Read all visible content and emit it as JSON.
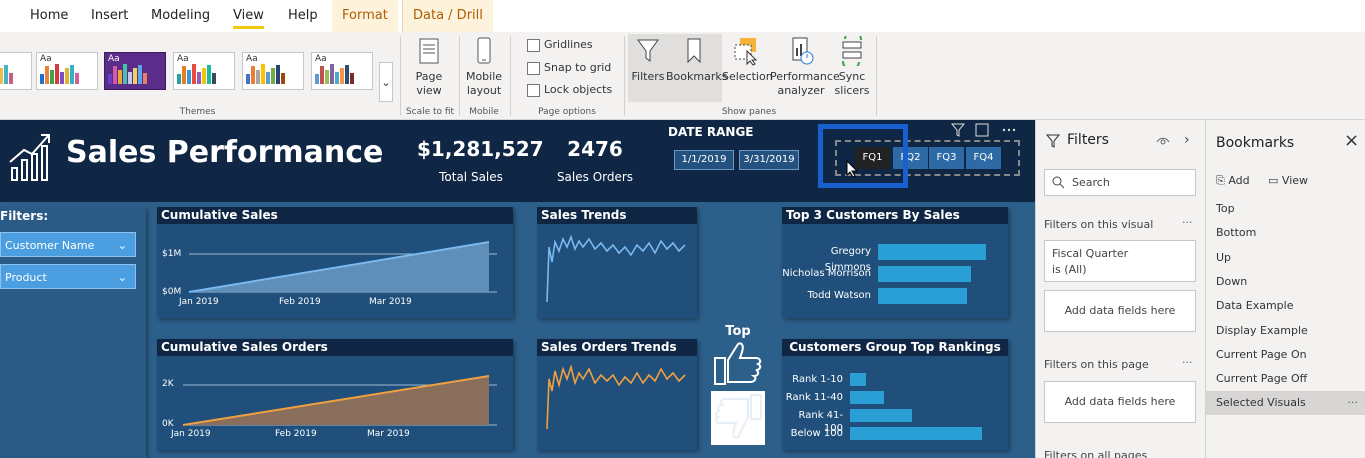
{
  "tabs": {
    "home": "Home",
    "insert": "Insert",
    "modeling": "Modeling",
    "view": "View",
    "help": "Help",
    "format": "Format",
    "data_drill": "Data / Drill"
  },
  "ribbon": {
    "themes_label": "Themes",
    "theme_aa": "Aa",
    "page_view": "Page view",
    "scale_to_fit": "Scale to fit",
    "mobile_layout": "Mobile layout",
    "mobile_label": "Mobile",
    "gridlines": "Gridlines",
    "snap_to_grid": "Snap to grid",
    "lock_objects": "Lock objects",
    "page_options": "Page options",
    "filters": "Filters",
    "bookmarks": "Bookmarks",
    "selection": "Selection",
    "performance_analyzer": "Performance analyzer",
    "sync_slicers": "Sync slicers",
    "show_panes": "Show panes"
  },
  "report": {
    "title": "Sales Performance",
    "total_sales_value": "$1,281,527",
    "total_sales_label": "Total Sales",
    "sales_orders_value": "2476",
    "sales_orders_label": "Sales Orders",
    "date_range_label": "DATE RANGE",
    "date_start": "1/1/2019",
    "date_end": "3/31/2019",
    "quarters": [
      "FQ1",
      "FQ2",
      "FQ3",
      "FQ4"
    ],
    "filters_label": "Filters:",
    "slicers": [
      "Customer Name",
      "Product"
    ],
    "top_label": "Top"
  },
  "charts": {
    "cumulative_sales": {
      "title": "Cumulative Sales",
      "y_ticks": [
        "$1M",
        "$0M"
      ],
      "x_ticks": [
        "Jan 2019",
        "Feb 2019",
        "Mar 2019"
      ]
    },
    "cumulative_orders": {
      "title": "Cumulative Sales Orders",
      "y_ticks": [
        "2K",
        "0K"
      ],
      "x_ticks": [
        "Jan 2019",
        "Feb 2019",
        "Mar 2019"
      ]
    },
    "sales_trends": {
      "title": "Sales Trends"
    },
    "orders_trends": {
      "title": "Sales Orders Trends"
    },
    "top_customers": {
      "title": "Top 3 Customers By Sales",
      "rows": [
        {
          "label": "Gregory Simmons",
          "value": 1.0
        },
        {
          "label": "Nicholas Morrison",
          "value": 0.86
        },
        {
          "label": "Todd Watson",
          "value": 0.82
        }
      ]
    },
    "group_rankings": {
      "title": "Customers Group Top Rankings",
      "rows": [
        {
          "label": "Rank 1-10",
          "value": 0.12
        },
        {
          "label": "Rank 11-40",
          "value": 0.26
        },
        {
          "label": "Rank 41-100",
          "value": 0.47
        },
        {
          "label": "Below 100",
          "value": 1.0
        }
      ]
    }
  },
  "filters_pane": {
    "title": "Filters",
    "search_placeholder": "Search",
    "on_visual": "Filters on this visual",
    "fiscal_quarter": "Fiscal Quarter",
    "is_all": "is (All)",
    "add_fields": "Add data fields here",
    "on_page": "Filters on this page",
    "on_all": "Filters on all pages"
  },
  "bookmarks_pane": {
    "title": "Bookmarks",
    "add": "Add",
    "view": "View",
    "items": [
      "Top",
      "Bottom",
      "Up",
      "Down",
      "Data Example",
      "Display Example",
      "Current Page On",
      "Current Page Off",
      "Selected Visuals"
    ],
    "selected_index": 8
  },
  "colors": {
    "accent": "#f2c811",
    "header": "#0f2744",
    "canvas": "#2c5f8a",
    "highlight_box": "#1a5fd0",
    "sales_line": "#7ab8f0",
    "orders_line": "#f0a040"
  }
}
